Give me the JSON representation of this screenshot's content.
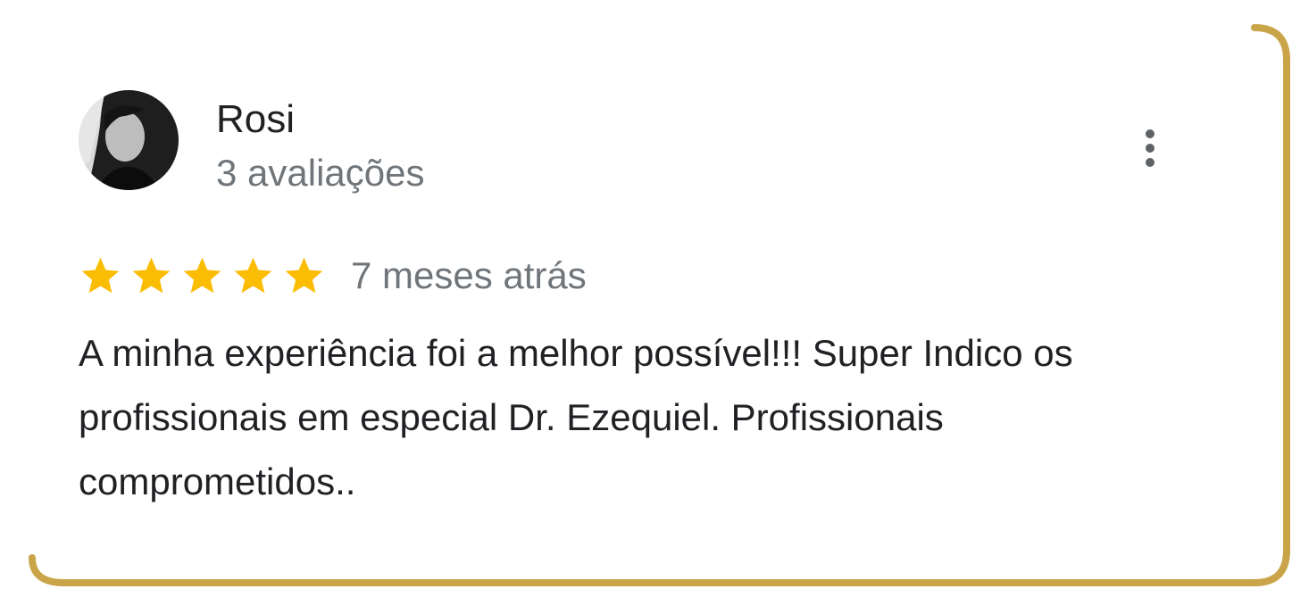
{
  "review": {
    "reviewer_name": "Rosi",
    "reviewer_meta": "3 avaliações",
    "avatar_icon": "reviewer-photo",
    "menu_icon": "more-vert-icon",
    "rating": 5,
    "rating_max": 5,
    "star_icon": "star-icon",
    "date": "7 meses atrás",
    "text": "A minha experiência foi a melhor possível!!! Super Indico os profissionais em especial Dr. Ezequiel. Profissionais comprometidos.."
  },
  "colors": {
    "frame_border": "#c9a449",
    "star": "#fbbc04",
    "name_text": "#202124",
    "secondary_text": "#70757a",
    "menu_icon": "#5f6368"
  }
}
